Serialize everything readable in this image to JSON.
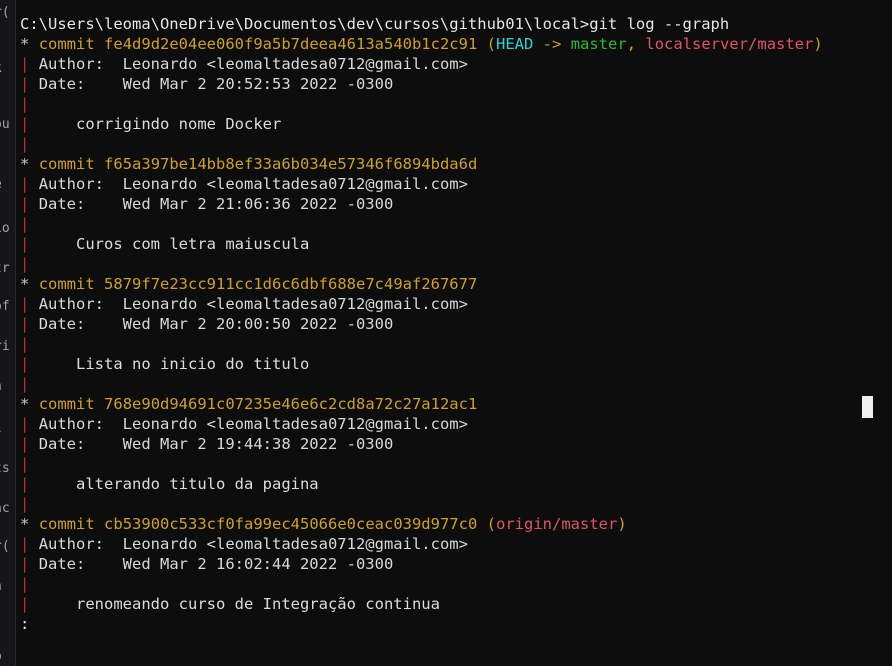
{
  "terminal": {
    "background_color": "#0d0d0d",
    "foreground_color": "#d8d8d8",
    "prompt_line": "C:\\Users\\leoma\\OneDrive\\Documentos\\dev\\cursos\\github01\\local>git log --graph",
    "pager_prompt": ":",
    "cursor": {
      "type": "block-cursor",
      "color": "#efefef"
    }
  },
  "colors": {
    "hash": "#cfa028",
    "head": "#2fd1d1",
    "local_branch": "#2fb82f",
    "remote_branch": "#e05561",
    "graph_pipe": "#c22b2b",
    "text": "#d8d8d8"
  },
  "labels": {
    "commit_keyword": "commit",
    "author_label": "Author:",
    "date_label": "Date:",
    "graph_node": "*",
    "graph_pipe": "|",
    "arrow": "->",
    "open_paren": "(",
    "close_paren": ")",
    "comma": ","
  },
  "log": {
    "author_name": "Leonardo",
    "author_email": "<leomaltadesa0712@gmail.com>",
    "commits": [
      {
        "hash": "fe4d9d2e04ee060f9a5b7deea4613a540b1c2c91",
        "head_ref": "HEAD",
        "local_branch": "master",
        "remote_branch": "localserver/master",
        "author": "Author:  Leonardo <leomaltadesa0712@gmail.com>",
        "date": "Date:    Wed Mar 2 20:52:53 2022 -0300",
        "message": "corrigindo nome Docker"
      },
      {
        "hash": "f65a397be14bb8ef33a6b034e57346f6894bda6d",
        "head_ref": "",
        "local_branch": "",
        "remote_branch": "",
        "author": "Author:  Leonardo <leomaltadesa0712@gmail.com>",
        "date": "Date:    Wed Mar 2 21:06:36 2022 -0300",
        "message": "Curos com letra maiuscula"
      },
      {
        "hash": "5879f7e23cc911cc1d6c6dbf688e7c49af267677",
        "head_ref": "",
        "local_branch": "",
        "remote_branch": "",
        "author": "Author:  Leonardo <leomaltadesa0712@gmail.com>",
        "date": "Date:    Wed Mar 2 20:00:50 2022 -0300",
        "message": "Lista no inicio do titulo"
      },
      {
        "hash": "768e90d94691c07235e46e6c2cd8a72c27a12ac1",
        "head_ref": "",
        "local_branch": "",
        "remote_branch": "",
        "author": "Author:  Leonardo <leomaltadesa0712@gmail.com>",
        "date": "Date:    Wed Mar 2 19:44:38 2022 -0300",
        "message": "alterando titulo da pagina"
      },
      {
        "hash": "cb53900c533cf0fa99ec45066e0ceac039d977c0",
        "head_ref": "",
        "local_branch": "",
        "remote_branch": "origin/master",
        "author": "Author:  Leonardo <leomaltadesa0712@gmail.com>",
        "date": "Date:    Wed Mar 2 16:02:44 2022 -0300",
        "message": "renomeando curso de Integração continua"
      }
    ]
  },
  "left_sliver": {
    "fragments": [
      "r(",
      "k",
      "ou",
      "e",
      "io",
      "tr",
      "of",
      "ri",
      "n",
      "l",
      "ts",
      "nc",
      "r(",
      "n",
      "o"
    ]
  }
}
